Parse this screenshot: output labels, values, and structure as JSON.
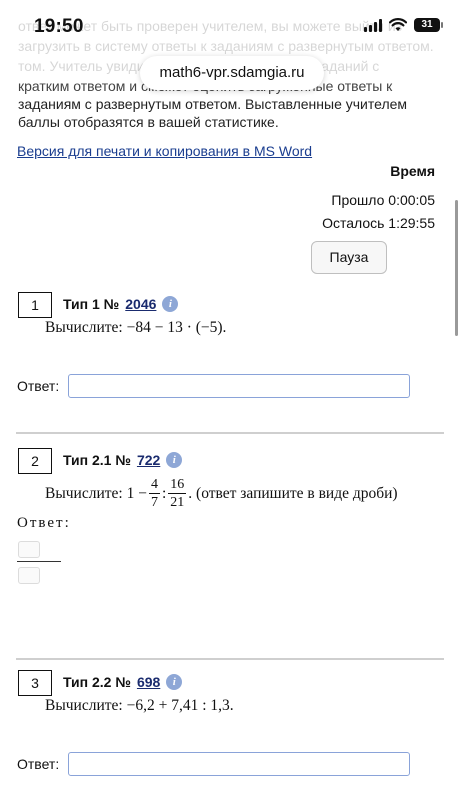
{
  "status_bar": {
    "time": "19:50",
    "battery": "31"
  },
  "browser": {
    "url": "math6-vpr.sdamgia.ru"
  },
  "intro": {
    "line1": "ответ может быть проверен учителем, вы можете выйти из",
    "line2": "загрузить в систему ответы к заданиям с развернутым ответом.",
    "line3": "том. Учитель увидит результаты выполнения заданий с",
    "line4": "кратким ответом и сможет оценить загруженные ответы к",
    "line5": "заданиям с развернутым ответом. Выставленные учителем",
    "line6": "баллы отобразятся в вашей статистике."
  },
  "print_link": "Версия для печати и копирования в MS Word",
  "timer": {
    "title": "Время",
    "elapsed": "Прошло 0:00:05",
    "remaining": "Осталось 1:29:55",
    "pause_label": "Пауза"
  },
  "tasks": [
    {
      "number": "1",
      "type_label": "Тип 1 №",
      "id": "2046",
      "question": "Вычислите: −84 − 13 · (−5).",
      "answer_label": "Ответ:"
    },
    {
      "number": "2",
      "type_label": "Тип 2.1 №",
      "id": "722",
      "q_prefix": "Вычислите: 1 −",
      "f1_num": "4",
      "f1_den": "7",
      "colon": ":",
      "f2_num": "16",
      "f2_den": "21",
      "q_suffix": ". (ответ запишите в виде дроби)",
      "answer_label": "Ответ:"
    },
    {
      "number": "3",
      "type_label": "Тип 2.2 №",
      "id": "698",
      "question": "Вычислите: −6,2 + 7,41 : 1,3.",
      "answer_label": "Ответ:"
    }
  ],
  "icons": {
    "info": "info-icon",
    "signal": "cellular-signal-icon",
    "wifi": "wifi-icon",
    "battery": "battery-icon"
  },
  "colors": {
    "link": "#1a3d8f",
    "input_border": "#8aa3d9",
    "info_icon": "#8ea7d6"
  }
}
